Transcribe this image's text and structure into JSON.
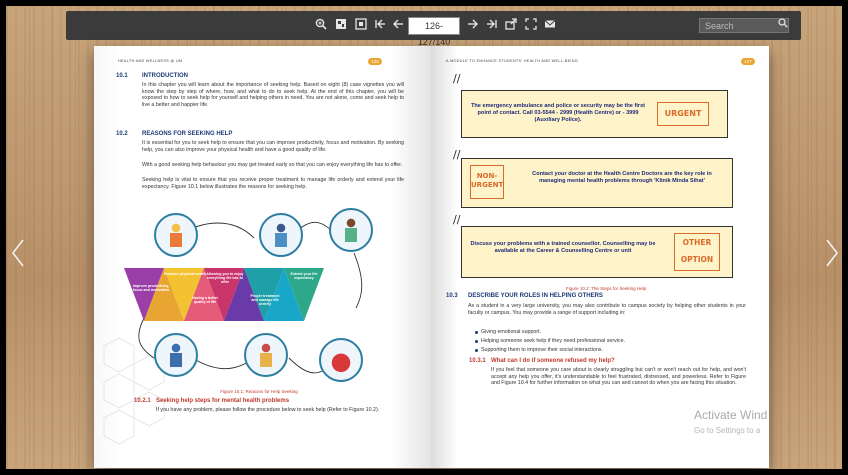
{
  "toolbar": {
    "icons": [
      "zoom-in-icon",
      "thumbnails-icon",
      "fit-page-icon",
      "first-page-icon",
      "previous-page-icon",
      "next-page-icon",
      "last-page-icon",
      "share-icon",
      "fullscreen-icon",
      "email-icon"
    ],
    "page_indicator": "126-127/140",
    "search_placeholder": "Search"
  },
  "left_page": {
    "header": "HEALTH AND WELLNESS @ UM",
    "page_number": "126",
    "sections": [
      {
        "num": "10.1",
        "title": "INTRODUCTION",
        "text": "In this chapter you will learn about the importance of seeking help. Based on eight (8) case vignettes you will know the step by step of where, how, and what to do to seek help. At the end of this chapter, you will be exposed to how to seek help for yourself and helping others in need. You are not alone, come and seek help to live a better and happier life."
      },
      {
        "num": "10.2",
        "title": "REASONS FOR SEEKING HELP",
        "paragraphs": [
          "It is essential for you to seek help to ensure that you can improve productivity, focus and motivation. By seeking help, you can also improve your physical health and have a good quality of life.",
          "With a good seeking help behaviour you may get treated early so that you can enjoy everything life has to offer.",
          "Seeking help is vital to ensure that you receive proper treatment to manage life orderly and extend your life expectancy. Figure 10.1 below illustrates the reasons for seeking help."
        ]
      }
    ],
    "infographic_labels": [
      "Improve productivity, focus and motivation",
      "Enhance physical health",
      "Having a better quality of life",
      "Allowing you to enjoy everything life has to offer",
      "Proper treatment and manage life orderly",
      "Extend your life expectancy"
    ],
    "figure_caption": "Figure 10.1: Reasons for Help Seeking",
    "subsection": {
      "num": "10.2.1",
      "title": "Seeking help steps for mental health problems",
      "text": "If you have any problem, please follow the procedure below to seek help (Refer to Figure 10.2)."
    }
  },
  "right_page": {
    "header": "A MODULE TO ENHANCE STUDENTS' HEALTH AND WELL-BEING",
    "page_number": "127",
    "boxes": [
      {
        "text": "The emergency ambulance and police or security may be the first point of contact. Call 03-5544 - 2999 (Health Centre) or - 3999 (Auxiliary Police).",
        "stamp": "URGENT"
      },
      {
        "text": "Contact your doctor at the Health Centre Doctors are the key role in managing mental health problems through 'Klinik Minda Sihat'",
        "stamp": "NON-URGENT"
      },
      {
        "text": "Discuss your problems with a trained counsellor. Counselling may be available at the Career & Counselling Centre or unit",
        "stamp": "OTHER OPTION"
      }
    ],
    "figure_caption": "Figure 10.2: The Steps for Seeking Help",
    "section": {
      "num": "10.3",
      "title": "DESCRIBE YOUR ROLES IN HELPING OTHERS",
      "text": "As a student in a very large university, you may also contribute to campus society by helping other students in your faculty or campus. You may provide a range of support including in:",
      "bullets": [
        "Giving emotional support.",
        "Helping someone seek help if they need professional service.",
        "Supporting them to improve their social interactions."
      ]
    },
    "subsection": {
      "num": "10.3.1",
      "title": "What can I do if someone refused my help?",
      "text": "If you feel that someone you care about is clearly struggling but can't or won't reach out for help, and won't accept any help you offer, it's understandable to feel frustrated, distressed, and powerless. Refer to Figure and Figure 10.4 for further information on what you can and cannot do when you are facing this situation."
    }
  },
  "watermark": {
    "line1": "Activate Wind",
    "line2": "Go to Settings to a"
  },
  "colors": {
    "toolbar": "#3b3b3b",
    "heading": "#1e3a78",
    "accent": "#e8a531",
    "note_bg": "#fff3c9",
    "stamp": "#d96b2b"
  }
}
